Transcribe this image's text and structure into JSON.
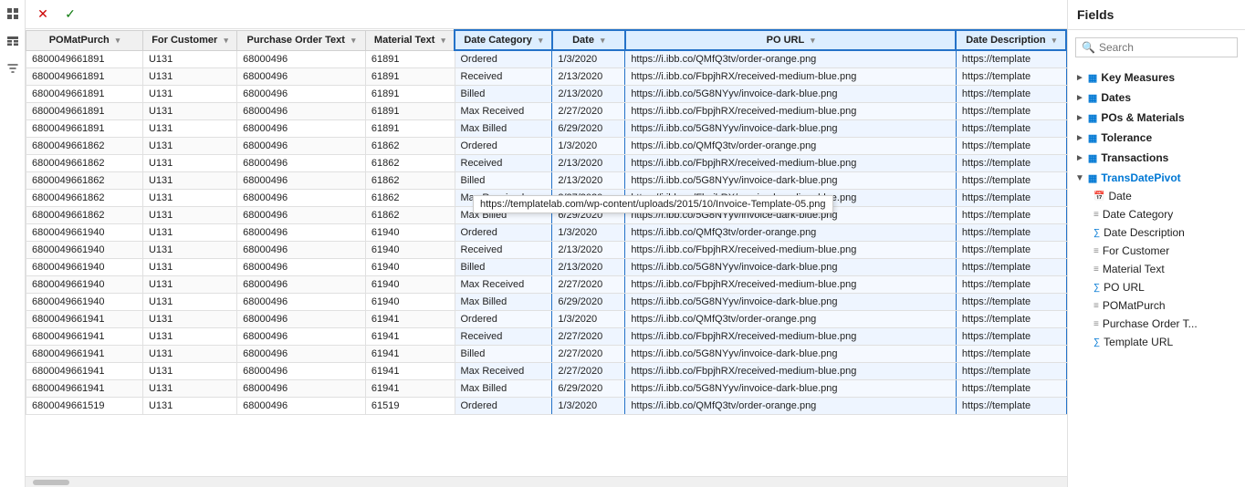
{
  "toolbar": {
    "close_label": "✕",
    "check_label": "✓",
    "grid_label": "⊞"
  },
  "table": {
    "columns": [
      {
        "id": "POMatPurch",
        "label": "POMatPurch",
        "highlighted": false
      },
      {
        "id": "ForCustomer",
        "label": "For Customer",
        "highlighted": false
      },
      {
        "id": "PurchaseOrderText",
        "label": "Purchase Order Text",
        "highlighted": false
      },
      {
        "id": "MaterialText",
        "label": "Material Text",
        "highlighted": false
      },
      {
        "id": "DateCategory",
        "label": "Date Category",
        "highlighted": true
      },
      {
        "id": "Date",
        "label": "Date",
        "highlighted": true
      },
      {
        "id": "POURL",
        "label": "PO URL",
        "highlighted": true
      },
      {
        "id": "DateDescription",
        "label": "Date Description",
        "highlighted": true
      }
    ],
    "rows": [
      {
        "POMatPurch": "6800049661891",
        "ForCustomer": "U131",
        "PurchaseOrderText": "68000496",
        "MaterialText": "61891",
        "DateCategory": "Ordered",
        "Date": "1/3/2020",
        "POURL": "https://i.ibb.co/QMfQ3tv/order-orange.png",
        "DateDescription": "https://template"
      },
      {
        "POMatPurch": "6800049661891",
        "ForCustomer": "U131",
        "PurchaseOrderText": "68000496",
        "MaterialText": "61891",
        "DateCategory": "Received",
        "Date": "2/13/2020",
        "POURL": "https://i.ibb.co/FbpjhRX/received-medium-blue.png",
        "DateDescription": "https://template"
      },
      {
        "POMatPurch": "6800049661891",
        "ForCustomer": "U131",
        "PurchaseOrderText": "68000496",
        "MaterialText": "61891",
        "DateCategory": "Billed",
        "Date": "2/13/2020",
        "POURL": "https://i.ibb.co/5G8NYyv/invoice-dark-blue.png",
        "DateDescription": "https://template"
      },
      {
        "POMatPurch": "6800049661891",
        "ForCustomer": "U131",
        "PurchaseOrderText": "68000496",
        "MaterialText": "61891",
        "DateCategory": "Max Received",
        "Date": "2/27/2020",
        "POURL": "https://i.ibb.co/FbpjhRX/received-medium-blue.png",
        "DateDescription": "https://template"
      },
      {
        "POMatPurch": "6800049661891",
        "ForCustomer": "U131",
        "PurchaseOrderText": "68000496",
        "MaterialText": "61891",
        "DateCategory": "Max Billed",
        "Date": "6/29/2020",
        "POURL": "https://i.ibb.co/5G8NYyv/invoice-dark-blue.png",
        "DateDescription": "https://template"
      },
      {
        "POMatPurch": "6800049661862",
        "ForCustomer": "U131",
        "PurchaseOrderText": "68000496",
        "MaterialText": "61862",
        "DateCategory": "Ordered",
        "Date": "1/3/2020",
        "POURL": "https://i.ibb.co/QMfQ3tv/order-orange.png",
        "DateDescription": "https://template"
      },
      {
        "POMatPurch": "6800049661862",
        "ForCustomer": "U131",
        "PurchaseOrderText": "68000496",
        "MaterialText": "61862",
        "DateCategory": "Received",
        "Date": "2/13/2020",
        "POURL": "https://i.ibb.co/FbpjhRX/received-medium-blue.png",
        "DateDescription": "https://template"
      },
      {
        "POMatPurch": "6800049661862",
        "ForCustomer": "U131",
        "PurchaseOrderText": "68000496",
        "MaterialText": "61862",
        "DateCategory": "Billed",
        "Date": "2/13/2020",
        "POURL": "https://i.ibb.co/5G8NYyv/invoice-dark-blue.png",
        "DateDescription": "https://template"
      },
      {
        "POMatPurch": "6800049661862",
        "ForCustomer": "U131",
        "PurchaseOrderText": "68000496",
        "MaterialText": "61862",
        "DateCategory": "Max Received",
        "Date": "2/27/2020",
        "POURL": "https://i.ibb.co/FbpjhRX/received-medium-blue.png",
        "DateDescription": "https://template"
      },
      {
        "POMatPurch": "6800049661862",
        "ForCustomer": "U131",
        "PurchaseOrderText": "68000496",
        "MaterialText": "61862",
        "DateCategory": "Max Billed",
        "Date": "6/29/2020",
        "POURL": "https://i.ibb.co/5G8NYyv/invoice-dark-blue.png",
        "DateDescription": "https://template"
      },
      {
        "POMatPurch": "6800049661940",
        "ForCustomer": "U131",
        "PurchaseOrderText": "68000496",
        "MaterialText": "61940",
        "DateCategory": "Ordered",
        "Date": "1/3/2020",
        "POURL": "https://i.ibb.co/QMfQ3tv/order-orange.png",
        "DateDescription": "https://template"
      },
      {
        "POMatPurch": "6800049661940",
        "ForCustomer": "U131",
        "PurchaseOrderText": "68000496",
        "MaterialText": "61940",
        "DateCategory": "Received",
        "Date": "2/13/2020",
        "POURL": "https://i.ibb.co/FbpjhRX/received-medium-blue.png",
        "DateDescription": "https://template"
      },
      {
        "POMatPurch": "6800049661940",
        "ForCustomer": "U131",
        "PurchaseOrderText": "68000496",
        "MaterialText": "61940",
        "DateCategory": "Billed",
        "Date": "2/13/2020",
        "POURL": "https://i.ibb.co/5G8NYyv/invoice-dark-blue.png",
        "DateDescription": "https://template"
      },
      {
        "POMatPurch": "6800049661940",
        "ForCustomer": "U131",
        "PurchaseOrderText": "68000496",
        "MaterialText": "61940",
        "DateCategory": "Max Received",
        "Date": "2/27/2020",
        "POURL": "https://i.ibb.co/FbpjhRX/received-medium-blue.png",
        "DateDescription": "https://template"
      },
      {
        "POMatPurch": "6800049661940",
        "ForCustomer": "U131",
        "PurchaseOrderText": "68000496",
        "MaterialText": "61940",
        "DateCategory": "Max Billed",
        "Date": "6/29/2020",
        "POURL": "https://i.ibb.co/5G8NYyv/invoice-dark-blue.png",
        "DateDescription": "https://template"
      },
      {
        "POMatPurch": "6800049661941",
        "ForCustomer": "U131",
        "PurchaseOrderText": "68000496",
        "MaterialText": "61941",
        "DateCategory": "Ordered",
        "Date": "1/3/2020",
        "POURL": "https://i.ibb.co/QMfQ3tv/order-orange.png",
        "DateDescription": "https://template"
      },
      {
        "POMatPurch": "6800049661941",
        "ForCustomer": "U131",
        "PurchaseOrderText": "68000496",
        "MaterialText": "61941",
        "DateCategory": "Received",
        "Date": "2/27/2020",
        "POURL": "https://i.ibb.co/FbpjhRX/received-medium-blue.png",
        "DateDescription": "https://template"
      },
      {
        "POMatPurch": "6800049661941",
        "ForCustomer": "U131",
        "PurchaseOrderText": "68000496",
        "MaterialText": "61941",
        "DateCategory": "Billed",
        "Date": "2/27/2020",
        "POURL": "https://i.ibb.co/5G8NYyv/invoice-dark-blue.png",
        "DateDescription": "https://template"
      },
      {
        "POMatPurch": "6800049661941",
        "ForCustomer": "U131",
        "PurchaseOrderText": "68000496",
        "MaterialText": "61941",
        "DateCategory": "Max Received",
        "Date": "2/27/2020",
        "POURL": "https://i.ibb.co/FbpjhRX/received-medium-blue.png",
        "DateDescription": "https://template"
      },
      {
        "POMatPurch": "6800049661941",
        "ForCustomer": "U131",
        "PurchaseOrderText": "68000496",
        "MaterialText": "61941",
        "DateCategory": "Max Billed",
        "Date": "6/29/2020",
        "POURL": "https://i.ibb.co/5G8NYyv/invoice-dark-blue.png",
        "DateDescription": "https://template"
      },
      {
        "POMatPurch": "6800049661519",
        "ForCustomer": "U131",
        "PurchaseOrderText": "68000496",
        "MaterialText": "61519",
        "DateCategory": "Ordered",
        "Date": "1/3/2020",
        "POURL": "https://i.ibb.co/QMfQ3tv/order-orange.png",
        "DateDescription": "https://template"
      }
    ]
  },
  "tooltip": {
    "text": "https://templatelab.com/wp-content/uploads/2015/10/Invoice-Template-05.png"
  },
  "fields_panel": {
    "title": "Fields",
    "search_placeholder": "Search",
    "groups": [
      {
        "label": "Key Measures",
        "icon": "table",
        "expanded": false,
        "items": []
      },
      {
        "label": "Dates",
        "icon": "table",
        "expanded": false,
        "items": []
      },
      {
        "label": "POs & Materials",
        "icon": "table",
        "expanded": false,
        "items": []
      },
      {
        "label": "Tolerance",
        "icon": "table",
        "expanded": false,
        "items": []
      },
      {
        "label": "Transactions",
        "icon": "table",
        "expanded": false,
        "items": []
      },
      {
        "label": "TransDatePivot",
        "icon": "table",
        "expanded": true,
        "items": [
          {
            "label": "Date",
            "icon": "calendar",
            "type": "field"
          },
          {
            "label": "Date Category",
            "icon": "text",
            "type": "field",
            "active": true
          },
          {
            "label": "Date Description",
            "icon": "text",
            "type": "field"
          },
          {
            "label": "For Customer",
            "icon": "text",
            "type": "field",
            "active": true
          },
          {
            "label": "Material Text",
            "icon": "text",
            "type": "field"
          },
          {
            "label": "PO URL",
            "icon": "sigma",
            "type": "measure"
          },
          {
            "label": "POMatPurch",
            "icon": "text",
            "type": "field"
          },
          {
            "label": "Purchase Order T...",
            "icon": "text",
            "type": "field"
          },
          {
            "label": "Template URL",
            "icon": "sigma",
            "type": "measure"
          }
        ]
      }
    ]
  }
}
